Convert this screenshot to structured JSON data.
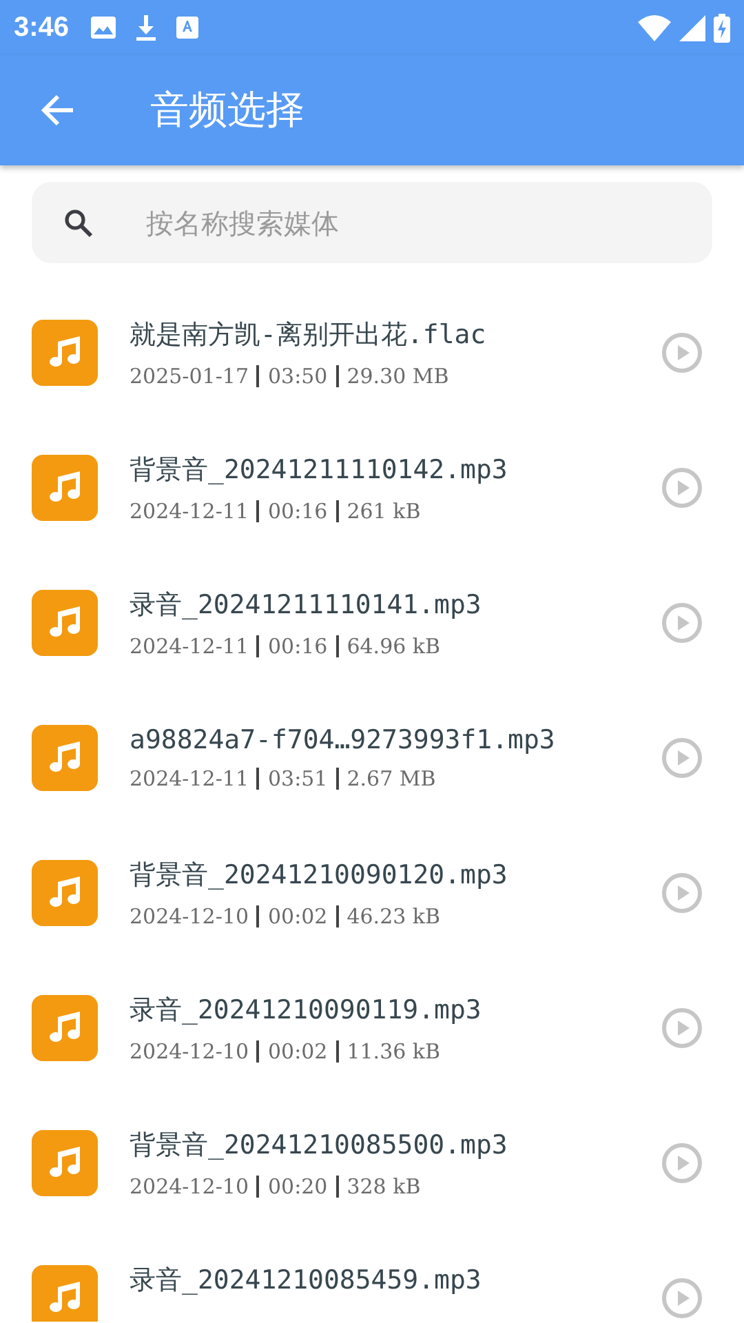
{
  "status_bar": {
    "time": "3:46"
  },
  "app_bar": {
    "title": "音频选择"
  },
  "search": {
    "placeholder": "按名称搜索媒体"
  },
  "files": [
    {
      "name": "就是南方凯-离别开出花.flac",
      "date": "2025-01-17",
      "duration": "03:50",
      "size": "29.30 MB"
    },
    {
      "name": "背景音_20241211110142.mp3",
      "date": "2024-12-11",
      "duration": "00:16",
      "size": "261 kB"
    },
    {
      "name": "录音_20241211110141.mp3",
      "date": "2024-12-11",
      "duration": "00:16",
      "size": "64.96 kB"
    },
    {
      "name": "a98824a7-f704…9273993f1.mp3",
      "date": "2024-12-11",
      "duration": "03:51",
      "size": "2.67 MB"
    },
    {
      "name": "背景音_20241210090120.mp3",
      "date": "2024-12-10",
      "duration": "00:02",
      "size": "46.23 kB"
    },
    {
      "name": "录音_20241210090119.mp3",
      "date": "2024-12-10",
      "duration": "00:02",
      "size": "11.36 kB"
    },
    {
      "name": "背景音_20241210085500.mp3",
      "date": "2024-12-10",
      "duration": "00:20",
      "size": "328 kB"
    },
    {
      "name": "录音_20241210085459.mp3"
    }
  ]
}
